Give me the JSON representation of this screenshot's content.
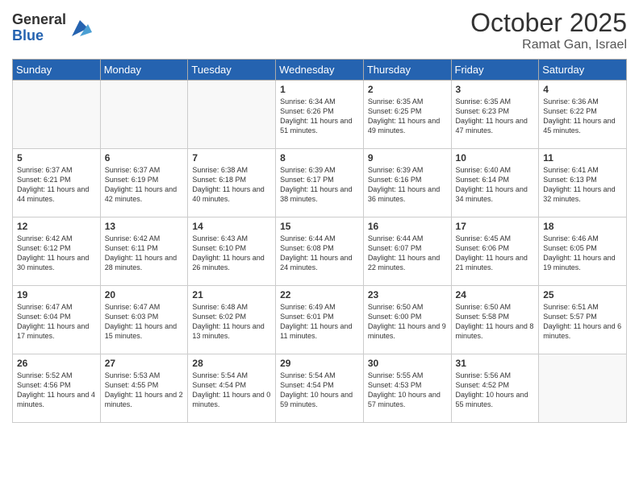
{
  "header": {
    "logo_general": "General",
    "logo_blue": "Blue",
    "month": "October 2025",
    "location": "Ramat Gan, Israel"
  },
  "weekdays": [
    "Sunday",
    "Monday",
    "Tuesday",
    "Wednesday",
    "Thursday",
    "Friday",
    "Saturday"
  ],
  "weeks": [
    [
      {
        "day": "",
        "empty": true
      },
      {
        "day": "",
        "empty": true
      },
      {
        "day": "",
        "empty": true
      },
      {
        "day": "1",
        "sunrise": "Sunrise: 6:34 AM",
        "sunset": "Sunset: 6:26 PM",
        "daylight": "Daylight: 11 hours and 51 minutes."
      },
      {
        "day": "2",
        "sunrise": "Sunrise: 6:35 AM",
        "sunset": "Sunset: 6:25 PM",
        "daylight": "Daylight: 11 hours and 49 minutes."
      },
      {
        "day": "3",
        "sunrise": "Sunrise: 6:35 AM",
        "sunset": "Sunset: 6:23 PM",
        "daylight": "Daylight: 11 hours and 47 minutes."
      },
      {
        "day": "4",
        "sunrise": "Sunrise: 6:36 AM",
        "sunset": "Sunset: 6:22 PM",
        "daylight": "Daylight: 11 hours and 45 minutes."
      }
    ],
    [
      {
        "day": "5",
        "sunrise": "Sunrise: 6:37 AM",
        "sunset": "Sunset: 6:21 PM",
        "daylight": "Daylight: 11 hours and 44 minutes."
      },
      {
        "day": "6",
        "sunrise": "Sunrise: 6:37 AM",
        "sunset": "Sunset: 6:19 PM",
        "daylight": "Daylight: 11 hours and 42 minutes."
      },
      {
        "day": "7",
        "sunrise": "Sunrise: 6:38 AM",
        "sunset": "Sunset: 6:18 PM",
        "daylight": "Daylight: 11 hours and 40 minutes."
      },
      {
        "day": "8",
        "sunrise": "Sunrise: 6:39 AM",
        "sunset": "Sunset: 6:17 PM",
        "daylight": "Daylight: 11 hours and 38 minutes."
      },
      {
        "day": "9",
        "sunrise": "Sunrise: 6:39 AM",
        "sunset": "Sunset: 6:16 PM",
        "daylight": "Daylight: 11 hours and 36 minutes."
      },
      {
        "day": "10",
        "sunrise": "Sunrise: 6:40 AM",
        "sunset": "Sunset: 6:14 PM",
        "daylight": "Daylight: 11 hours and 34 minutes."
      },
      {
        "day": "11",
        "sunrise": "Sunrise: 6:41 AM",
        "sunset": "Sunset: 6:13 PM",
        "daylight": "Daylight: 11 hours and 32 minutes."
      }
    ],
    [
      {
        "day": "12",
        "sunrise": "Sunrise: 6:42 AM",
        "sunset": "Sunset: 6:12 PM",
        "daylight": "Daylight: 11 hours and 30 minutes."
      },
      {
        "day": "13",
        "sunrise": "Sunrise: 6:42 AM",
        "sunset": "Sunset: 6:11 PM",
        "daylight": "Daylight: 11 hours and 28 minutes."
      },
      {
        "day": "14",
        "sunrise": "Sunrise: 6:43 AM",
        "sunset": "Sunset: 6:10 PM",
        "daylight": "Daylight: 11 hours and 26 minutes."
      },
      {
        "day": "15",
        "sunrise": "Sunrise: 6:44 AM",
        "sunset": "Sunset: 6:08 PM",
        "daylight": "Daylight: 11 hours and 24 minutes."
      },
      {
        "day": "16",
        "sunrise": "Sunrise: 6:44 AM",
        "sunset": "Sunset: 6:07 PM",
        "daylight": "Daylight: 11 hours and 22 minutes."
      },
      {
        "day": "17",
        "sunrise": "Sunrise: 6:45 AM",
        "sunset": "Sunset: 6:06 PM",
        "daylight": "Daylight: 11 hours and 21 minutes."
      },
      {
        "day": "18",
        "sunrise": "Sunrise: 6:46 AM",
        "sunset": "Sunset: 6:05 PM",
        "daylight": "Daylight: 11 hours and 19 minutes."
      }
    ],
    [
      {
        "day": "19",
        "sunrise": "Sunrise: 6:47 AM",
        "sunset": "Sunset: 6:04 PM",
        "daylight": "Daylight: 11 hours and 17 minutes."
      },
      {
        "day": "20",
        "sunrise": "Sunrise: 6:47 AM",
        "sunset": "Sunset: 6:03 PM",
        "daylight": "Daylight: 11 hours and 15 minutes."
      },
      {
        "day": "21",
        "sunrise": "Sunrise: 6:48 AM",
        "sunset": "Sunset: 6:02 PM",
        "daylight": "Daylight: 11 hours and 13 minutes."
      },
      {
        "day": "22",
        "sunrise": "Sunrise: 6:49 AM",
        "sunset": "Sunset: 6:01 PM",
        "daylight": "Daylight: 11 hours and 11 minutes."
      },
      {
        "day": "23",
        "sunrise": "Sunrise: 6:50 AM",
        "sunset": "Sunset: 6:00 PM",
        "daylight": "Daylight: 11 hours and 9 minutes."
      },
      {
        "day": "24",
        "sunrise": "Sunrise: 6:50 AM",
        "sunset": "Sunset: 5:58 PM",
        "daylight": "Daylight: 11 hours and 8 minutes."
      },
      {
        "day": "25",
        "sunrise": "Sunrise: 6:51 AM",
        "sunset": "Sunset: 5:57 PM",
        "daylight": "Daylight: 11 hours and 6 minutes."
      }
    ],
    [
      {
        "day": "26",
        "sunrise": "Sunrise: 5:52 AM",
        "sunset": "Sunset: 4:56 PM",
        "daylight": "Daylight: 11 hours and 4 minutes."
      },
      {
        "day": "27",
        "sunrise": "Sunrise: 5:53 AM",
        "sunset": "Sunset: 4:55 PM",
        "daylight": "Daylight: 11 hours and 2 minutes."
      },
      {
        "day": "28",
        "sunrise": "Sunrise: 5:54 AM",
        "sunset": "Sunset: 4:54 PM",
        "daylight": "Daylight: 11 hours and 0 minutes."
      },
      {
        "day": "29",
        "sunrise": "Sunrise: 5:54 AM",
        "sunset": "Sunset: 4:54 PM",
        "daylight": "Daylight: 10 hours and 59 minutes."
      },
      {
        "day": "30",
        "sunrise": "Sunrise: 5:55 AM",
        "sunset": "Sunset: 4:53 PM",
        "daylight": "Daylight: 10 hours and 57 minutes."
      },
      {
        "day": "31",
        "sunrise": "Sunrise: 5:56 AM",
        "sunset": "Sunset: 4:52 PM",
        "daylight": "Daylight: 10 hours and 55 minutes."
      },
      {
        "day": "",
        "empty": true
      }
    ]
  ]
}
